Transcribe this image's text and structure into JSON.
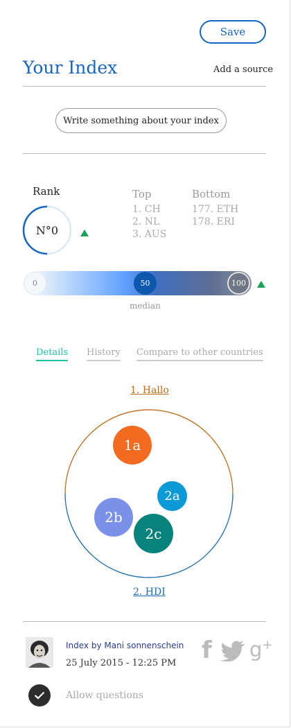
{
  "header": {
    "save_label": "Save",
    "title": "Your Index",
    "add_source_label": "Add a source"
  },
  "description_button_label": "Write something about your index",
  "rank": {
    "label": "Rank",
    "value_text": "N°0",
    "trend": "up"
  },
  "top": {
    "heading": "Top",
    "items": [
      "1. CH",
      "2. NL",
      "3. AUS"
    ]
  },
  "bottom": {
    "heading": "Bottom",
    "items": [
      "177. ETH",
      "178. ERI"
    ]
  },
  "scale": {
    "min_label": "0",
    "median_value_label": "50",
    "max_label": "100",
    "median_caption": "median",
    "median_fraction": 0.5,
    "trend": "up"
  },
  "tabs": [
    {
      "label": "Details",
      "active": true
    },
    {
      "label": "History",
      "active": false
    },
    {
      "label": "Compare to other countries",
      "active": false
    }
  ],
  "diagram": {
    "top_label": "1. Hallo",
    "bottom_label": "2. HDI",
    "bubbles": [
      {
        "label": "1a",
        "color": "#f26b21"
      },
      {
        "label": "2a",
        "color": "#0a9ad8"
      },
      {
        "label": "2b",
        "color": "#7b90e8"
      },
      {
        "label": "2c",
        "color": "#08837c"
      }
    ],
    "top_color": "#c06b1a",
    "bottom_color": "#1a6bb0"
  },
  "author": {
    "by_line": "Index by Mani sonnenschein",
    "date": "25 July 2015 - 12:25 PM"
  },
  "social": [
    "facebook-icon",
    "twitter-icon",
    "google-plus-icon"
  ],
  "allow_questions_label": "Allow questions",
  "colors": {
    "primary": "#1565c0",
    "accent_green": "#1aa05a",
    "tab_active": "#1fbfa0"
  }
}
